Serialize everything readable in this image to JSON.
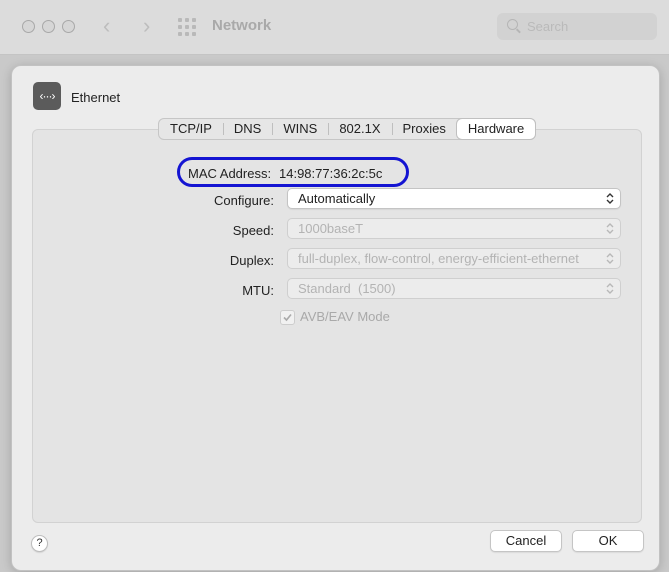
{
  "window": {
    "title": "Network",
    "search_placeholder": "Search"
  },
  "service": {
    "icon_glyph": "‹···›",
    "name": "Ethernet"
  },
  "tabs": [
    {
      "label": "TCP/IP"
    },
    {
      "label": "DNS"
    },
    {
      "label": "WINS"
    },
    {
      "label": "802.1X"
    },
    {
      "label": "Proxies"
    },
    {
      "label": "Hardware"
    }
  ],
  "active_tab": "Hardware",
  "hardware": {
    "mac_label": "MAC Address:",
    "mac_value": "14:98:77:36:2c:5c",
    "configure_label": "Configure:",
    "configure_value": "Automatically",
    "speed_label": "Speed:",
    "speed_value": "1000baseT",
    "duplex_label": "Duplex:",
    "duplex_value": "full-duplex, flow-control, energy-efficient-ethernet",
    "mtu_label": "MTU:",
    "mtu_value": "Standard  (1500)",
    "avb_label": "AVB/EAV Mode"
  },
  "footer": {
    "help_label": "?",
    "cancel_label": "Cancel",
    "ok_label": "OK"
  },
  "colors": {
    "annotation_oval": "#1414d2"
  }
}
